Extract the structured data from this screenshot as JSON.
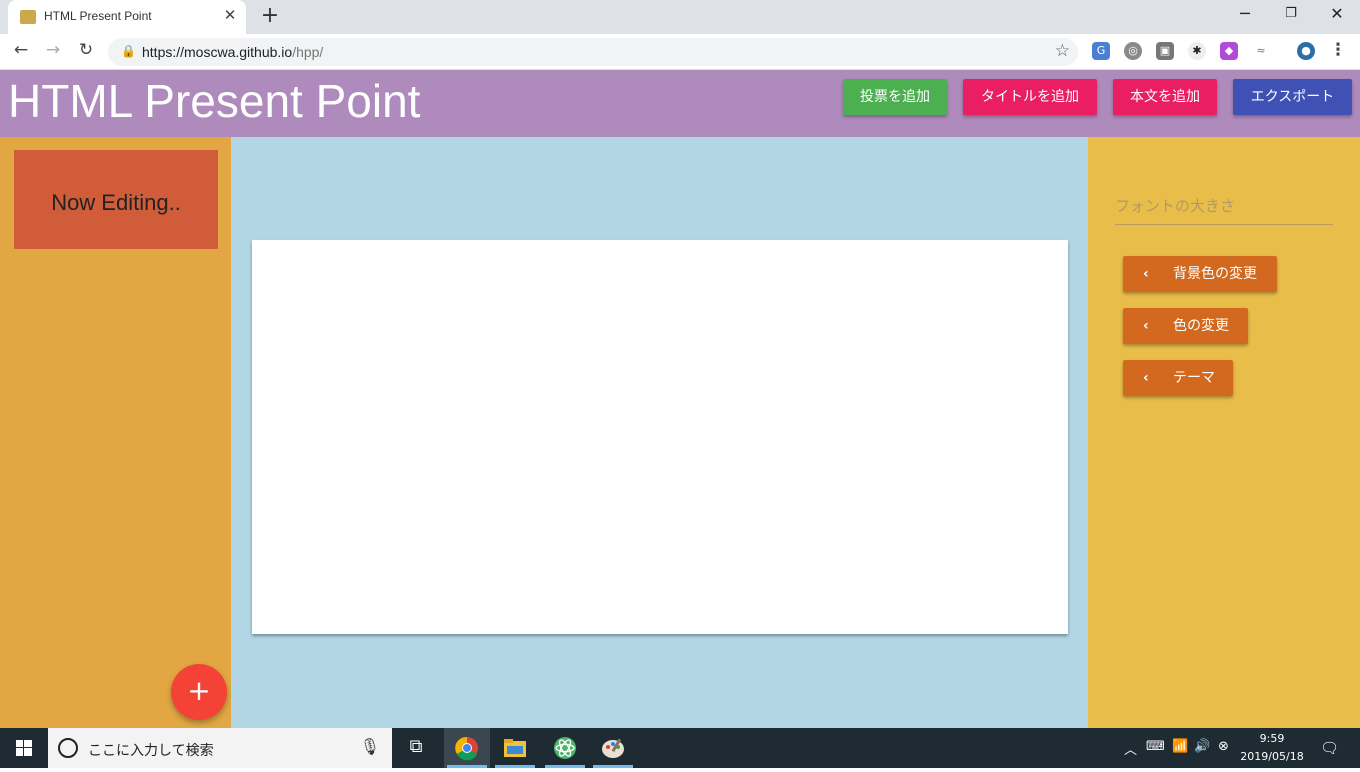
{
  "browser": {
    "tab_title": "HTML Present Point",
    "url_host": "https://moscwa.github.io",
    "url_path": "/hpp/"
  },
  "header": {
    "title": "HTML Present Point",
    "buttons": [
      {
        "label": "投票を追加",
        "color": "#4caf50"
      },
      {
        "label": "タイトルを追加",
        "color": "#e91e63"
      },
      {
        "label": "本文を追加",
        "color": "#e91e63"
      },
      {
        "label": "エクスポート",
        "color": "#3f51b5"
      }
    ]
  },
  "sidebar": {
    "slide_thumb_label": "Now Editing..",
    "fab_label": "+"
  },
  "panel": {
    "font_size_placeholder": "フォントの大きさ",
    "buttons": [
      {
        "label": "背景色の変更"
      },
      {
        "label": "色の変更"
      },
      {
        "label": "テーマ"
      }
    ]
  },
  "taskbar": {
    "search_placeholder": "ここに入力して検索",
    "time": "9:59",
    "date": "2019/05/18"
  },
  "colors": {
    "header_bg": "#af8abc",
    "left_bg": "#e2a742",
    "center_bg": "#b2d6e4",
    "right_bg": "#e9bd49",
    "thumb_bg": "#d15c3a",
    "panel_button": "#d2691e",
    "fab": "#f44336"
  }
}
